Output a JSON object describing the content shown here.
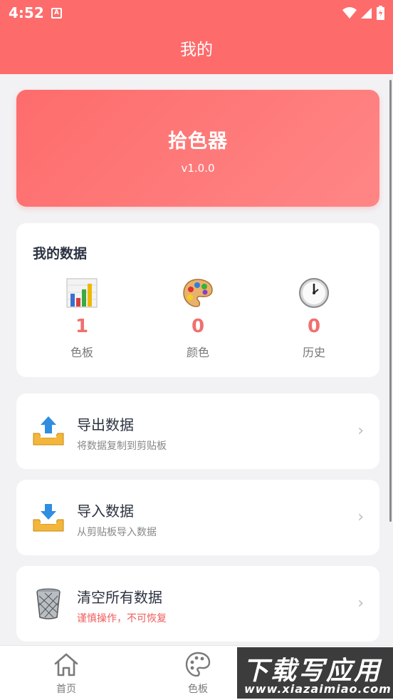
{
  "status_bar": {
    "time": "4:52",
    "notification_icon": "A"
  },
  "app_bar": {
    "title": "我的"
  },
  "hero": {
    "title": "拾色器",
    "version": "v1.0.0"
  },
  "stats": {
    "title": "我的数据",
    "items": [
      {
        "icon": "bar-chart-icon",
        "value": "1",
        "label": "色板"
      },
      {
        "icon": "palette-icon",
        "value": "0",
        "label": "颜色"
      },
      {
        "icon": "clock-icon",
        "value": "0",
        "label": "历史"
      }
    ]
  },
  "menu": [
    {
      "icon": "export-tray-icon",
      "title": "导出数据",
      "subtitle": "将数据复制到剪贴板"
    },
    {
      "icon": "import-tray-icon",
      "title": "导入数据",
      "subtitle": "从剪贴板导入数据"
    },
    {
      "icon": "trash-bin-icon",
      "title": "清空所有数据",
      "subtitle": "谨慎操作，不可恢复"
    }
  ],
  "bottom_nav": [
    {
      "icon": "home-icon",
      "label": "首页"
    },
    {
      "icon": "palette-outline-icon",
      "label": "色板"
    }
  ],
  "watermark": {
    "main": "下载写应用",
    "sub": "www.xiazaimiao.com"
  },
  "colors": {
    "accent": "#fe6b6b",
    "value": "#f07070",
    "warn": "#f05a5a"
  }
}
